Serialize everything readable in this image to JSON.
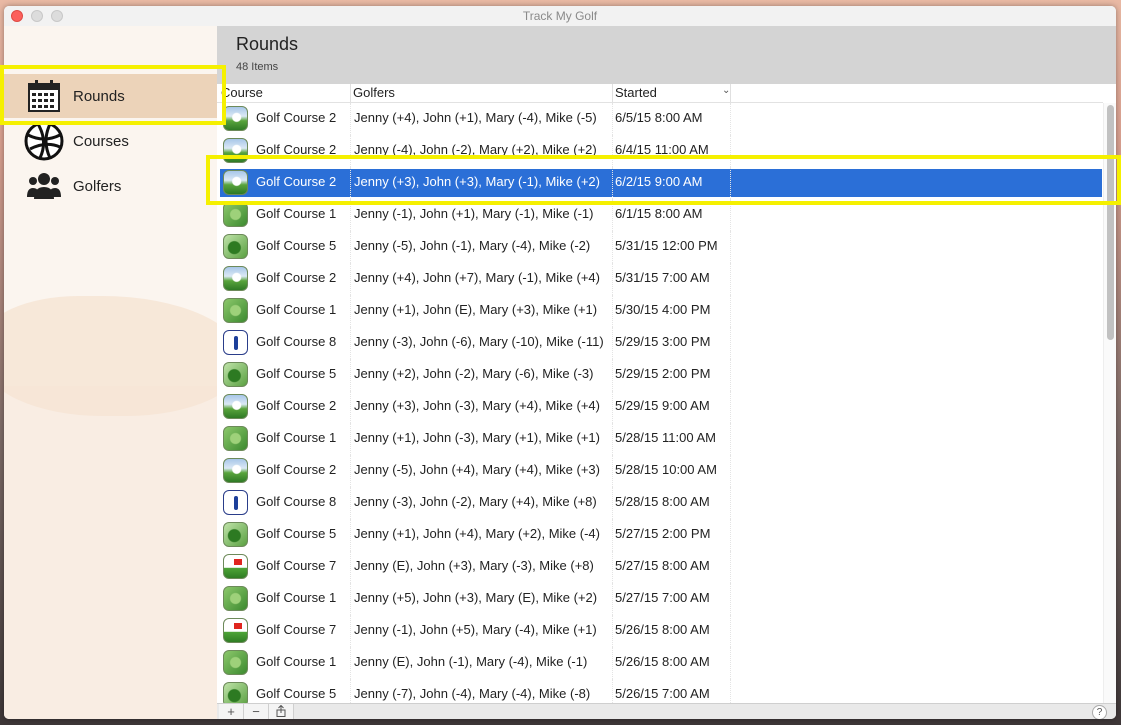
{
  "window": {
    "title": "Track My Golf"
  },
  "sidebar": {
    "items": [
      {
        "label": "Rounds",
        "icon": "calendar-icon",
        "selected": true
      },
      {
        "label": "Courses",
        "icon": "globe-icon",
        "selected": false
      },
      {
        "label": "Golfers",
        "icon": "people-icon",
        "selected": false
      }
    ]
  },
  "header": {
    "title": "Rounds",
    "count": "48 Items"
  },
  "table": {
    "columns": [
      "Course",
      "Golfers",
      "Started"
    ],
    "rows": [
      {
        "course": "Golf Course 2",
        "golfers": "Jenny (+4), John (+1), Mary (-4), Mike (-5)",
        "started": "6/5/15 8:00 AM"
      },
      {
        "course": "Golf Course 2",
        "golfers": "Jenny (-4), John (-2), Mary (+2), Mike (+2)",
        "started": "6/4/15 11:00 AM"
      },
      {
        "course": "Golf Course 2",
        "golfers": "Jenny (+3), John (+3), Mary (-1), Mike (+2)",
        "started": "6/2/15 9:00 AM"
      },
      {
        "course": "Golf Course 1",
        "golfers": "Jenny (-1), John (+1), Mary (-1), Mike (-1)",
        "started": "6/1/15 8:00 AM"
      },
      {
        "course": "Golf Course 5",
        "golfers": "Jenny (-5), John (-1), Mary (-4), Mike (-2)",
        "started": "5/31/15 12:00 PM"
      },
      {
        "course": "Golf Course 2",
        "golfers": "Jenny (+4), John (+7), Mary (-1), Mike (+4)",
        "started": "5/31/15 7:00 AM"
      },
      {
        "course": "Golf Course 1",
        "golfers": "Jenny (+1), John (E), Mary (+3), Mike (+1)",
        "started": "5/30/15 4:00 PM"
      },
      {
        "course": "Golf Course 8",
        "golfers": "Jenny (-3), John (-6), Mary (-10), Mike (-11)",
        "started": "5/29/15 3:00 PM"
      },
      {
        "course": "Golf Course 5",
        "golfers": "Jenny (+2), John (-2), Mary (-6), Mike (-3)",
        "started": "5/29/15 2:00 PM"
      },
      {
        "course": "Golf Course 2",
        "golfers": "Jenny (+3), John (-3), Mary (+4), Mike (+4)",
        "started": "5/29/15 9:00 AM"
      },
      {
        "course": "Golf Course 1",
        "golfers": "Jenny (+1), John (-3), Mary (+1), Mike (+1)",
        "started": "5/28/15 11:00 AM"
      },
      {
        "course": "Golf Course 2",
        "golfers": "Jenny (-5), John (+4), Mary (+4), Mike (+3)",
        "started": "5/28/15 10:00 AM"
      },
      {
        "course": "Golf Course 8",
        "golfers": "Jenny (-3), John (-2), Mary (+4), Mike (+8)",
        "started": "5/28/15 8:00 AM"
      },
      {
        "course": "Golf Course 5",
        "golfers": "Jenny (+1), John (+4), Mary (+2), Mike (-4)",
        "started": "5/27/15 2:00 PM"
      },
      {
        "course": "Golf Course 7",
        "golfers": "Jenny (E), John (+3), Mary (-3), Mike (+8)",
        "started": "5/27/15 8:00 AM"
      },
      {
        "course": "Golf Course 1",
        "golfers": "Jenny (+5), John (+3), Mary (E), Mike (+2)",
        "started": "5/27/15 7:00 AM"
      },
      {
        "course": "Golf Course 7",
        "golfers": "Jenny (-1), John (+5), Mary (-4), Mike (+1)",
        "started": "5/26/15 8:00 AM"
      },
      {
        "course": "Golf Course 1",
        "golfers": "Jenny (E), John (-1), Mary (-4), Mike (-1)",
        "started": "5/26/15 8:00 AM"
      },
      {
        "course": "Golf Course 5",
        "golfers": "Jenny (-7), John (-4), Mary (-4), Mike (-8)",
        "started": "5/26/15 7:00 AM"
      }
    ],
    "selected_row": 2
  },
  "footer": {
    "add": "+",
    "remove": "−",
    "help": "?"
  },
  "colors": {
    "selection": "#2b6fd7",
    "highlight": "#f5f000",
    "sidebar_selected": "#ecd3b9"
  }
}
